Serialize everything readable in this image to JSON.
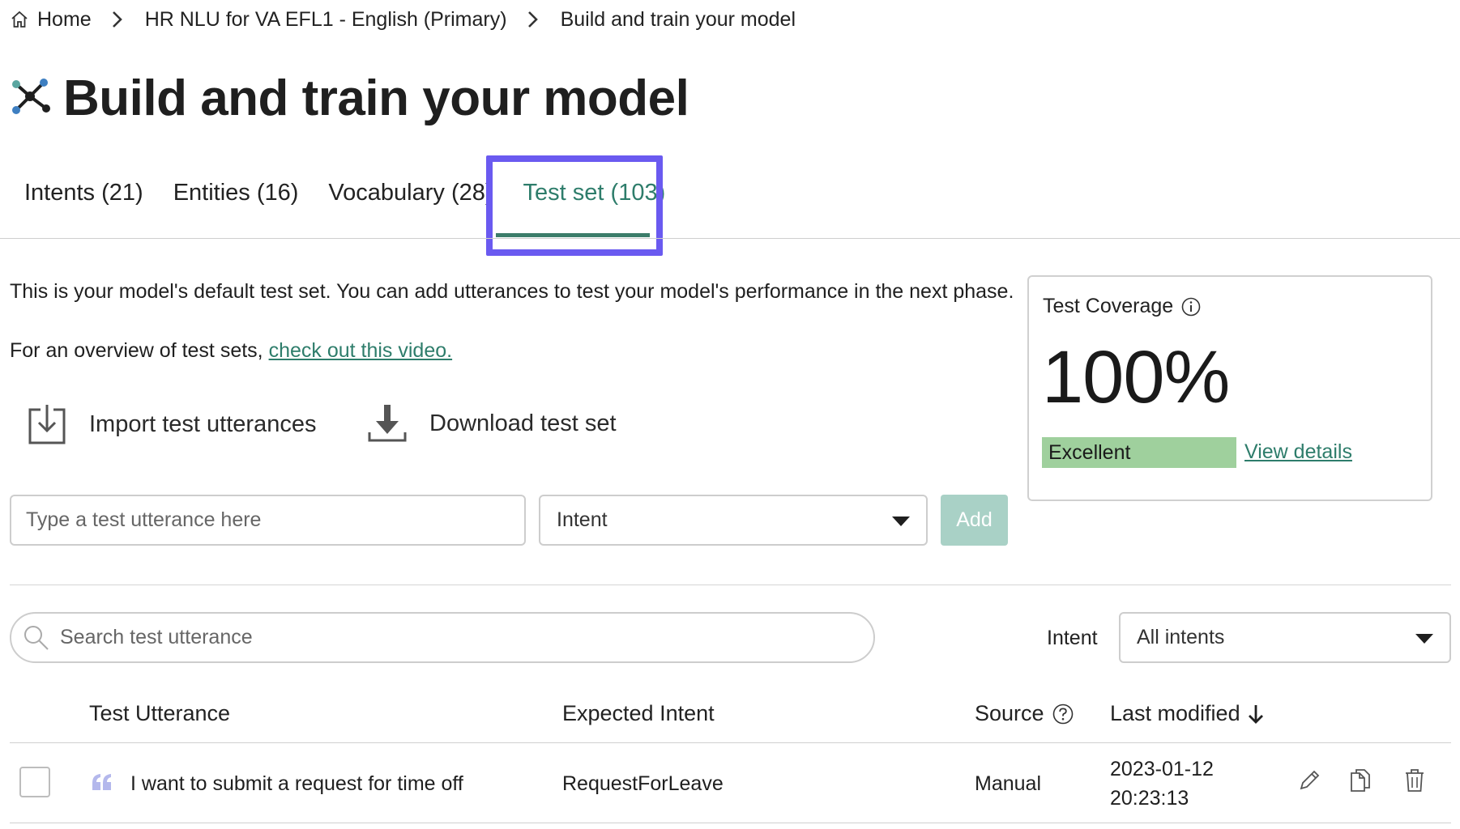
{
  "breadcrumb": {
    "home": "Home",
    "project": "HR NLU for VA EFL1 - English (Primary)",
    "current": "Build and train your model"
  },
  "page": {
    "title": "Build and train your model"
  },
  "tabs": [
    {
      "label": "Intents (21)"
    },
    {
      "label": "Entities (16)"
    },
    {
      "label": "Vocabulary (28)"
    },
    {
      "label": "Test set (103)",
      "active": true
    }
  ],
  "description": {
    "line1": "This is your model's default test set. You can add utterances to test your model's performance in the next phase.",
    "line2_prefix": "For an overview of test sets,",
    "line2_link": "check out this video."
  },
  "actions": {
    "import_label": "Import test utterances",
    "download_label": "Download test set"
  },
  "add_form": {
    "utterance_placeholder": "Type a test utterance here",
    "intent_placeholder": "Intent",
    "add_label": "Add"
  },
  "coverage": {
    "label": "Test Coverage",
    "value": "100%",
    "rating": "Excellent",
    "details_link": "View details"
  },
  "filter": {
    "search_placeholder": "Search test utterance",
    "intent_label": "Intent",
    "intent_value": "All intents"
  },
  "table": {
    "columns": {
      "utterance": "Test Utterance",
      "intent": "Expected Intent",
      "source": "Source",
      "modified": "Last modified"
    },
    "rows": [
      {
        "utterance": "I want to submit a request for time off",
        "intent": "RequestForLeave",
        "source": "Manual",
        "date": "2023-01-12",
        "time": "20:23:13"
      }
    ]
  },
  "colors": {
    "accent": "#2e7d6b",
    "focus": "#6a5af0",
    "coverage_bar": "#9fd09d",
    "add_button": "#a9d1c6"
  }
}
